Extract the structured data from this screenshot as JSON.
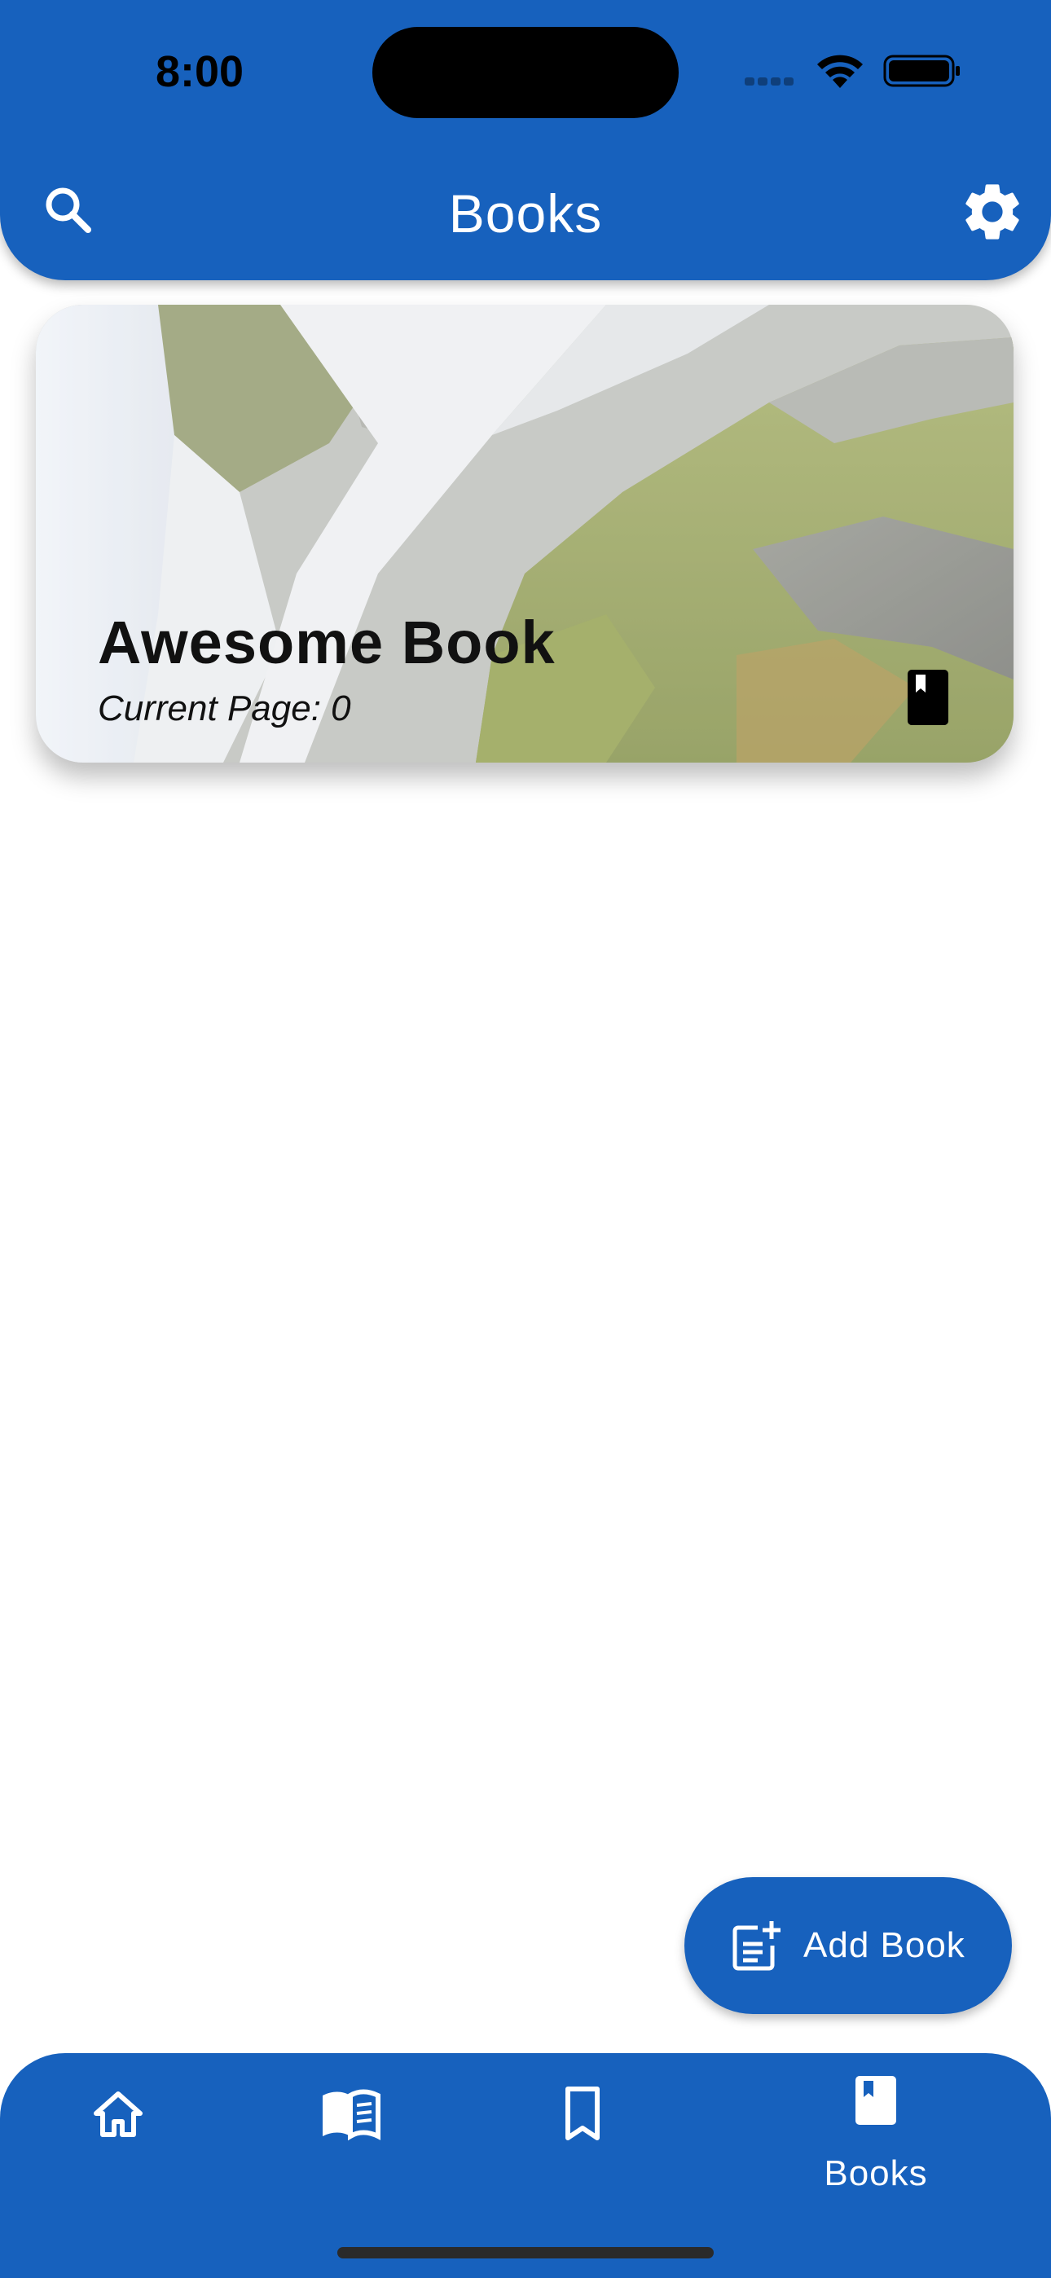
{
  "status_bar": {
    "time": "8:00"
  },
  "header": {
    "title": "Books",
    "search_icon": "search-icon",
    "settings_icon": "gear-icon"
  },
  "books": [
    {
      "title": "Awesome Book",
      "current_page": "Current Page: 0",
      "icon": "book-icon"
    }
  ],
  "fab": {
    "label": "Add Book",
    "icon": "post-add-icon"
  },
  "bottom_nav": {
    "items": [
      {
        "icon": "home-icon",
        "label": ""
      },
      {
        "icon": "open-book-icon",
        "label": ""
      },
      {
        "icon": "bookmark-icon",
        "label": ""
      },
      {
        "icon": "book-icon",
        "label": "Books",
        "selected": true
      }
    ]
  },
  "colors": {
    "primary": "#1761BD",
    "on_primary": "#FFFFFF",
    "background": "#FFFFFF"
  }
}
